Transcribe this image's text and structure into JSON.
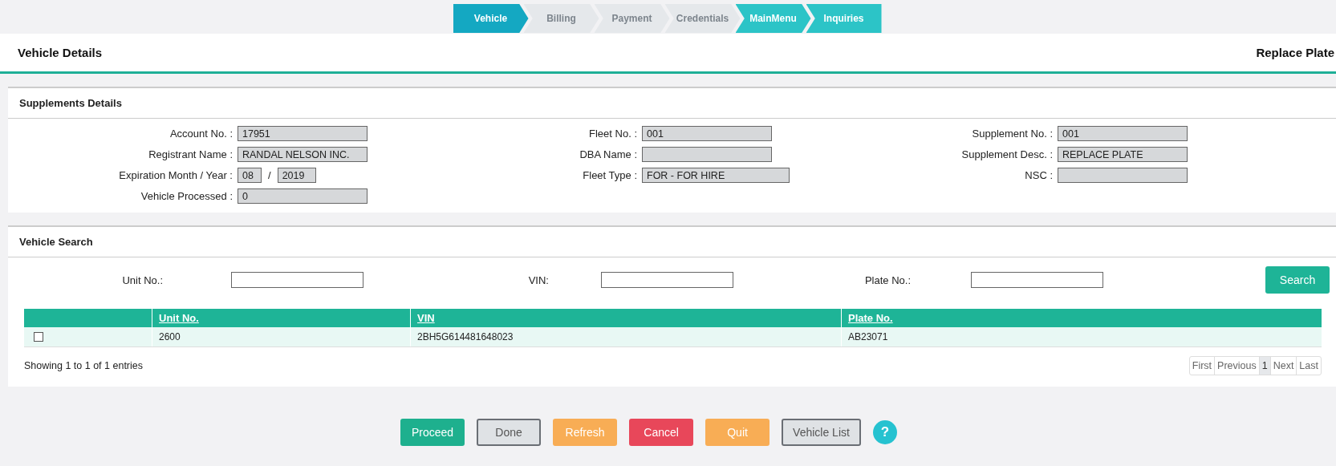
{
  "wizard": [
    {
      "label": "Vehicle",
      "selected": true,
      "enabled": true
    },
    {
      "label": "Billing",
      "selected": false,
      "enabled": false
    },
    {
      "label": "Payment",
      "selected": false,
      "enabled": false
    },
    {
      "label": "Credentials",
      "selected": false,
      "enabled": false
    },
    {
      "label": "MainMenu",
      "selected": false,
      "enabled": true
    },
    {
      "label": "Inquiries",
      "selected": false,
      "enabled": true
    }
  ],
  "header": {
    "title": "Vehicle Details",
    "action": "Replace Plate"
  },
  "supplements": {
    "title": "Supplements Details",
    "columns": [
      [
        {
          "label": "Account No. :",
          "values": [
            "17951"
          ]
        },
        {
          "label": "Registrant Name :",
          "values": [
            "RANDAL NELSON INC."
          ]
        },
        {
          "label": "Expiration Month / Year :",
          "values": [
            "08",
            "2019"
          ],
          "separator": "/"
        },
        {
          "label": "Vehicle Processed :",
          "values": [
            "0"
          ]
        }
      ],
      [
        {
          "label": "Fleet No. :",
          "values": [
            "001"
          ]
        },
        {
          "label": "DBA Name :"
        },
        {
          "label": "Fleet Type :",
          "values": [
            "FOR - FOR HIRE"
          ],
          "wide": true
        }
      ],
      [
        {
          "label": "Supplement No. :",
          "values": [
            "001"
          ]
        },
        {
          "label": "Supplement Desc. :",
          "values": [
            "REPLACE PLATE"
          ]
        },
        {
          "label": "NSC :"
        }
      ]
    ]
  },
  "vehicle_search": {
    "title": "Vehicle Search",
    "fields": [
      {
        "label": "Unit No.:"
      },
      {
        "label": "VIN:"
      },
      {
        "label": "Plate No.:"
      }
    ],
    "search_button": "Search",
    "table": {
      "columns": [
        "Unit No.",
        "VIN",
        "Plate No."
      ],
      "rows": [
        {
          "checked": false,
          "cells": [
            "2600",
            "2BH5G614481648023",
            "AB23071"
          ]
        }
      ]
    },
    "info": "Showing 1 to 1 of 1 entries",
    "pagination": [
      {
        "label": "First",
        "selected": false
      },
      {
        "label": "Previous",
        "selected": false
      },
      {
        "label": "1",
        "selected": true
      },
      {
        "label": "Next",
        "selected": false
      },
      {
        "label": "Last",
        "selected": false
      }
    ]
  },
  "buttons": [
    {
      "label": "Proceed",
      "kind": "primary"
    },
    {
      "label": "Done",
      "kind": "default"
    },
    {
      "label": "Refresh",
      "kind": "warning"
    },
    {
      "label": "Cancel",
      "kind": "danger"
    },
    {
      "label": "Quit",
      "kind": "warning"
    },
    {
      "label": "Vehicle List",
      "kind": "default"
    }
  ],
  "help": "?"
}
